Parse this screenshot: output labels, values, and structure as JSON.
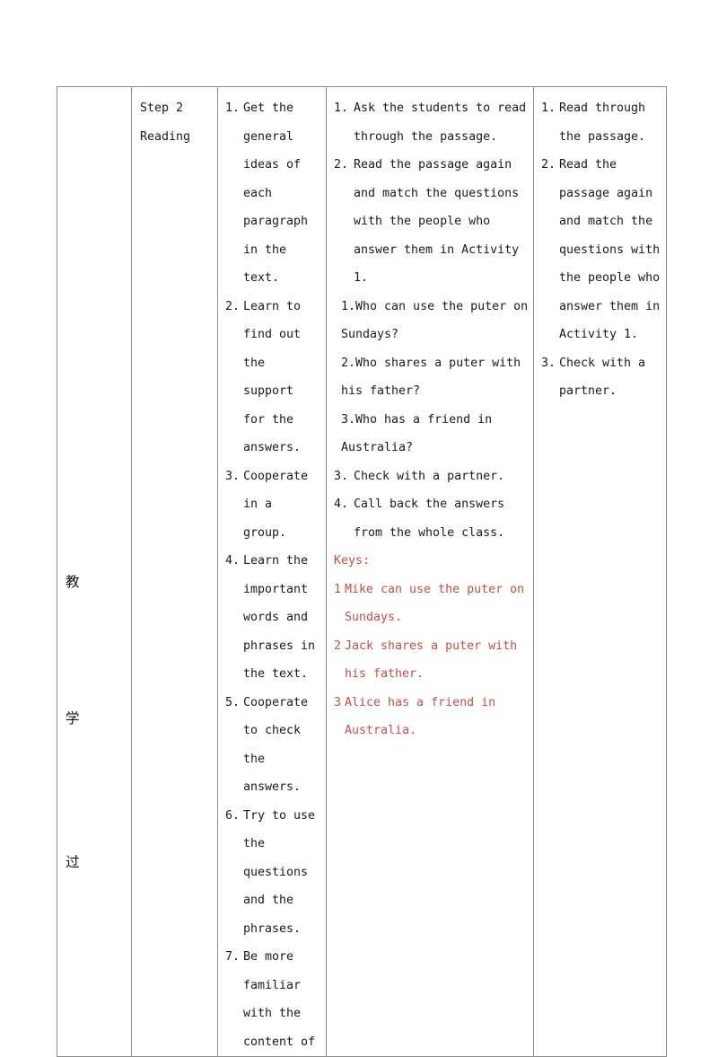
{
  "document": {
    "type": "lesson-plan-table",
    "red_accent": "#c0504d",
    "text_color": "#1a1a1a",
    "border_color": "#8c8c8c"
  },
  "vertical_label": {
    "name": "teaching-process-label",
    "chars": [
      "教",
      "学",
      "过"
    ]
  },
  "step": {
    "title": "Step 2",
    "subtitle": "Reading"
  },
  "aims": {
    "items": [
      {
        "num": "1.",
        "text": "Get the general ideas of each paragraph in the text."
      },
      {
        "num": "2.",
        "text": "Learn to find out the support for the answers."
      },
      {
        "num": "3.",
        "text": "Cooperate in a group."
      },
      {
        "num": "4.",
        "text": "Learn the important words and phrases in the text."
      },
      {
        "num": "5.",
        "text": "Cooperate to check the answers."
      },
      {
        "num": "6.",
        "text": "Try to use the questions and the phrases."
      },
      {
        "num": "7.",
        "text": "Be more familiar with the content of"
      }
    ]
  },
  "teacher_activity": {
    "items": [
      {
        "num": "1.",
        "text": "Ask the students to read through the passage."
      },
      {
        "num": "2.",
        "text": "Read the passage again and match the questions with the people who answer them in Activity 1."
      }
    ],
    "sub_questions": [
      {
        "num": "1.",
        "text": "Who can use the puter on Sundays?"
      },
      {
        "num": "2.",
        "text": "Who shares a puter with his father?"
      },
      {
        "num": "3.",
        "text": "Who has a friend in Australia?"
      }
    ],
    "items_cont": [
      {
        "num": "3.",
        "text": "Check with a partner."
      },
      {
        "num": "4.",
        "text": "Call back the answers from the whole class."
      }
    ],
    "keys_label": "Keys:",
    "keys": [
      {
        "num": "1",
        "text": "Mike can use the puter on Sundays."
      },
      {
        "num": "2",
        "text": "Jack shares a puter with his father."
      },
      {
        "num": "3",
        "text": "Alice has a friend in Australia."
      }
    ]
  },
  "student_activity": {
    "items": [
      {
        "num": "1.",
        "text": "Read through the passage."
      },
      {
        "num": "2.",
        "text": "Read the passage again and match the questions with the people who answer them in Activity 1."
      },
      {
        "num": "3.",
        "text": "Check with a partner."
      }
    ]
  }
}
